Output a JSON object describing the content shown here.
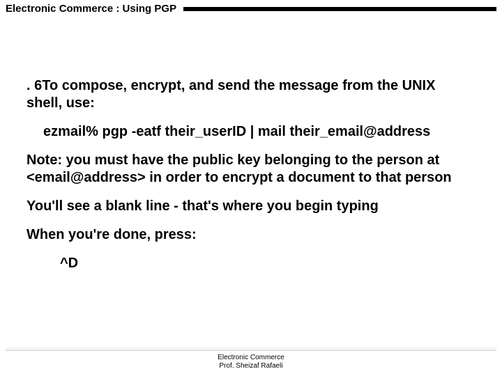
{
  "header": {
    "title": "Electronic Commerce :  Using PGP"
  },
  "body": {
    "p1": ". 6To compose, encrypt, and send the message from the UNIX shell, use:",
    "p2": "ezmail% pgp -eatf their_userID | mail their_email@address",
    "p3": "Note: you must have the public key belonging to the person at <email@address> in order to encrypt a document to that person",
    "p4": "You'll see a blank line - that's where you begin typing",
    "p5": "When you're done, press:",
    "p6": "^D"
  },
  "footer": {
    "line1": "Electronic Commerce",
    "line2": "Prof. Sheizaf Rafaeli"
  }
}
